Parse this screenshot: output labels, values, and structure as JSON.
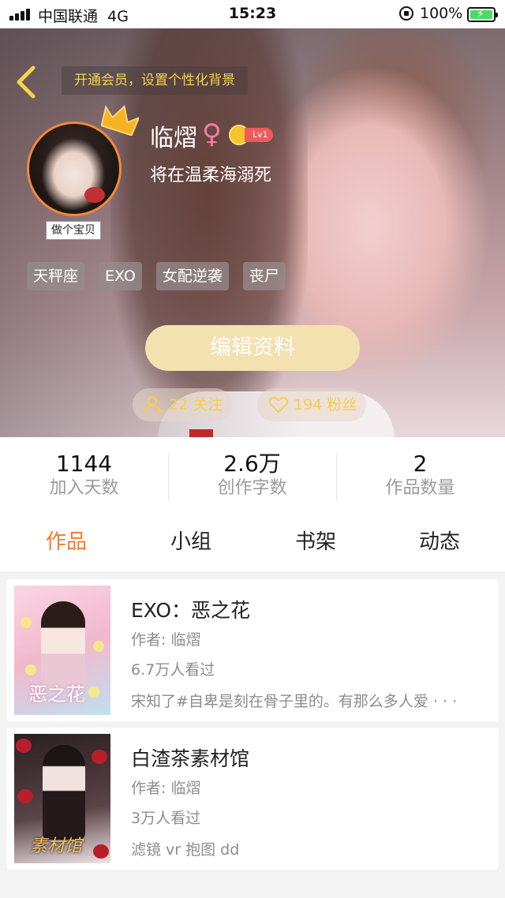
{
  "status_bar": {
    "carrier": "中国联通",
    "network": "4G",
    "time": "15:23",
    "battery": "100%",
    "battery_level": 1.0
  },
  "profile": {
    "vip_banner": "开通会员，设置个性化背景",
    "username": "临熠",
    "gender_symbol": "♀",
    "level": "Lv1",
    "signature": "将在温柔海溺死",
    "avatar_badge": "做个宝贝",
    "tags": [
      "天秤座",
      "EXO",
      "女配逆袭",
      "丧尸"
    ],
    "edit_button": "编辑资料",
    "following": "22 关注",
    "fans": "194 粉丝",
    "accent_color": "#f47a2e"
  },
  "stats": [
    {
      "value": "1144",
      "label": "加入天数"
    },
    {
      "value": "2.6万",
      "label": "创作字数"
    },
    {
      "value": "2",
      "label": "作品数量"
    }
  ],
  "tabs": [
    {
      "label": "作品",
      "active": true
    },
    {
      "label": "小组",
      "active": false
    },
    {
      "label": "书架",
      "active": false
    },
    {
      "label": "动态",
      "active": false
    }
  ],
  "works": [
    {
      "title": "EXO：恶之花",
      "author": "作者: 临熠",
      "views": "6.7万人看过",
      "description": "宋知了#自卑是刻在骨子里的。有那么多人爱 · · ·",
      "cover_text": "恶之花"
    },
    {
      "title": "白渣茶素材馆",
      "author": "作者: 临熠",
      "views": "3万人看过",
      "description": "滤镜 vr 抱图 dd",
      "cover_text": "素材馆"
    }
  ]
}
